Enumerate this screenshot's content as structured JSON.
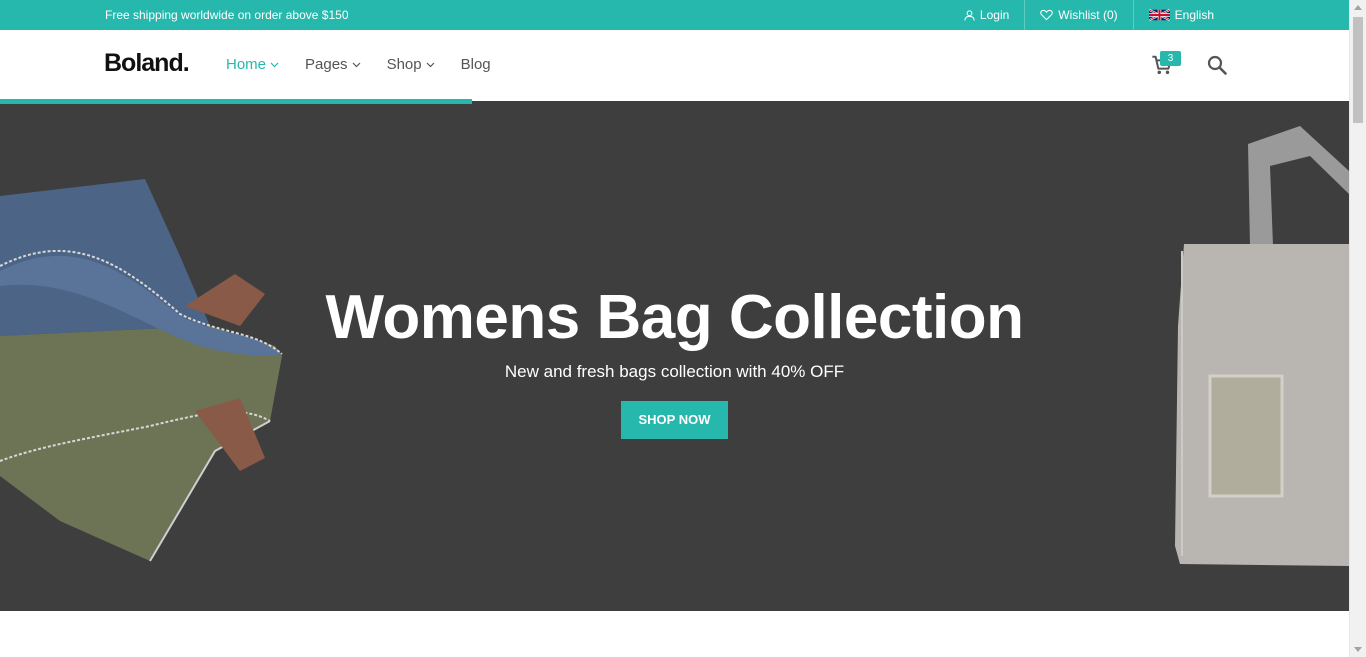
{
  "topbar": {
    "promo": "Free shipping worldwide on order above $150",
    "login": "Login",
    "wishlist": "Wishlist (0)",
    "language": "English"
  },
  "header": {
    "logo": "Boland.",
    "nav": [
      {
        "label": "Home",
        "dropdown": true,
        "active": true
      },
      {
        "label": "Pages",
        "dropdown": true
      },
      {
        "label": "Shop",
        "dropdown": true
      },
      {
        "label": "Blog",
        "dropdown": false
      }
    ],
    "cart_count": "3",
    "icons": [
      "user-icon",
      "heart-icon",
      "uk-flag-icon",
      "cart-icon",
      "search-icon",
      "chevron-down-icon"
    ]
  },
  "slider": {
    "progress": 0.35
  },
  "hero": {
    "title": "Womens Bag Collection",
    "subtitle": "New and fresh bags collection with 40% OFF",
    "button": "SHOP NOW"
  },
  "colors": {
    "accent": "#26b8ad",
    "hero_background": "#3e3e3e",
    "text_dark": "#111111",
    "nav_text": "#555555"
  }
}
